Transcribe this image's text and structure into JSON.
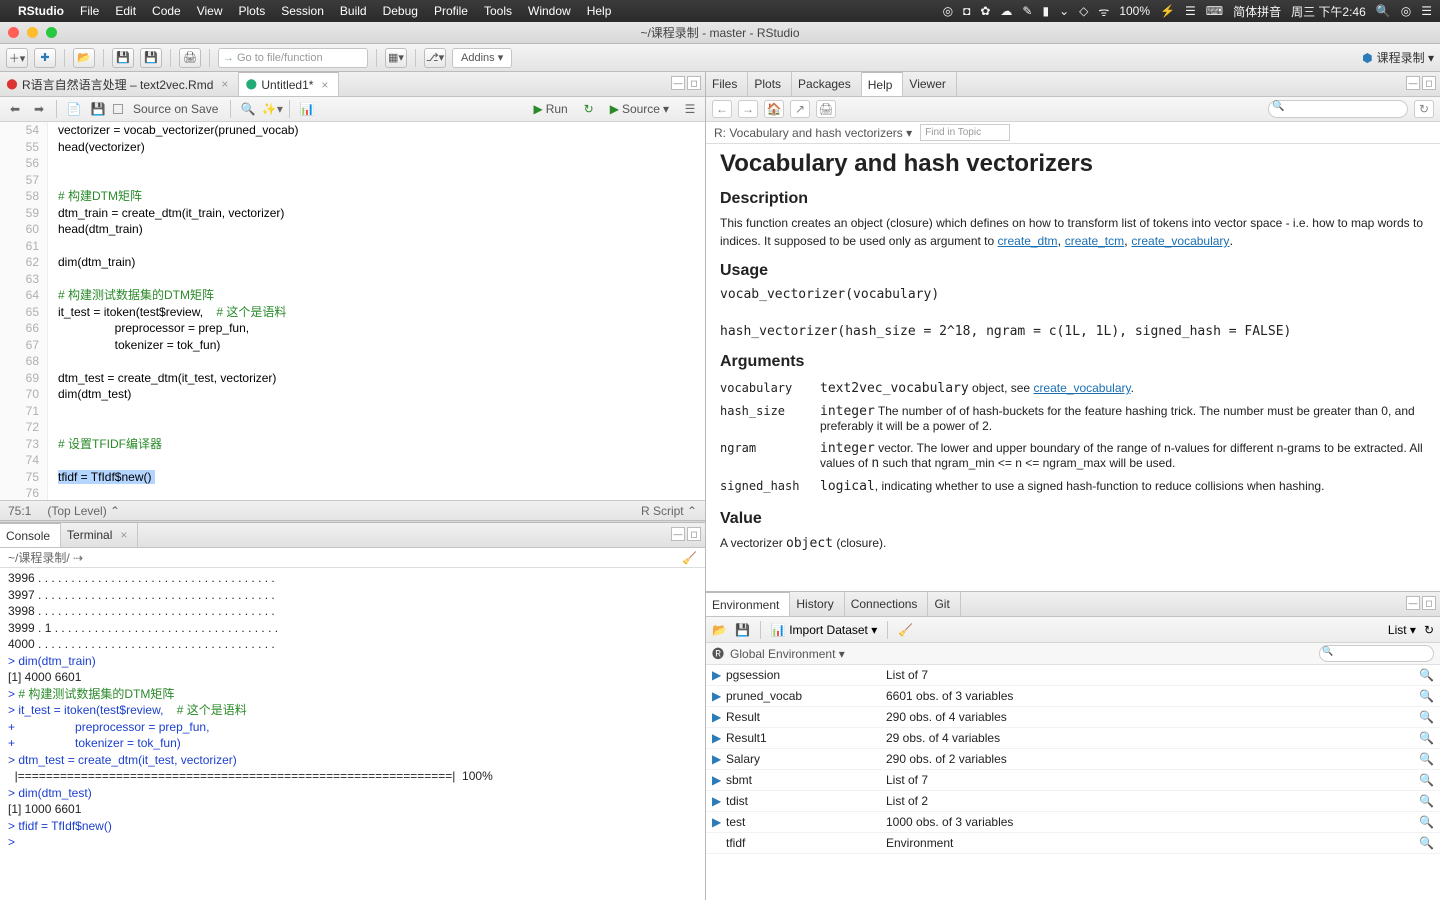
{
  "menubar": {
    "app": "RStudio",
    "items": [
      "File",
      "Edit",
      "Code",
      "View",
      "Plots",
      "Session",
      "Build",
      "Debug",
      "Profile",
      "Tools",
      "Window",
      "Help"
    ],
    "status_right": [
      "◎",
      "◘",
      "✿",
      "☁",
      "✎",
      "▮",
      "⌄",
      "◇",
      "ᯤ",
      "100%",
      "⚡",
      "☰",
      "⌨",
      "简体拼音",
      "周三 下午2:46",
      "🔍",
      "◎",
      "☰"
    ]
  },
  "titlebar": {
    "title": "~/课程录制 - master - RStudio"
  },
  "main_toolbar": {
    "goto_placeholder": "Go to file/function",
    "addins": "Addins  ▾",
    "project": "课程录制 ▾"
  },
  "source": {
    "tabs": [
      {
        "icon": "⬤",
        "label": "R语言自然语言处理 – text2vec.Rmd",
        "closable": true,
        "active": false,
        "icon_color": "#d33"
      },
      {
        "icon": "⬤",
        "label": "Untitled1*",
        "closable": true,
        "active": true,
        "icon_color": "#2a7"
      }
    ],
    "toolbar": {
      "save_on_src": "Source on Save",
      "run": "Run",
      "source_btn": "Source"
    },
    "line_start": 54,
    "lines": [
      {
        "n": 54,
        "t": "vectorizer = vocab_vectorizer(pruned_vocab)"
      },
      {
        "n": 55,
        "t": "head(vectorizer)"
      },
      {
        "n": 56,
        "t": ""
      },
      {
        "n": 57,
        "t": ""
      },
      {
        "n": 58,
        "t": "# 构建DTM矩阵",
        "c": true
      },
      {
        "n": 59,
        "t": "dtm_train = create_dtm(it_train, vectorizer)"
      },
      {
        "n": 60,
        "t": "head(dtm_train)"
      },
      {
        "n": 61,
        "t": ""
      },
      {
        "n": 62,
        "t": "dim(dtm_train)"
      },
      {
        "n": 63,
        "t": ""
      },
      {
        "n": 64,
        "t": "# 构建测试数据集的DTM矩阵",
        "c": true
      },
      {
        "n": 65,
        "t": "it_test = itoken(test$review,    ",
        "tc": "# 这个是语料"
      },
      {
        "n": 66,
        "t": "                 preprocessor = prep_fun,"
      },
      {
        "n": 67,
        "t": "                 tokenizer = tok_fun)"
      },
      {
        "n": 68,
        "t": ""
      },
      {
        "n": 69,
        "t": "dtm_test = create_dtm(it_test, vectorizer)"
      },
      {
        "n": 70,
        "t": "dim(dtm_test)"
      },
      {
        "n": 71,
        "t": ""
      },
      {
        "n": 72,
        "t": ""
      },
      {
        "n": 73,
        "t": "# 设置TFIDF编译器",
        "c": true
      },
      {
        "n": 74,
        "t": ""
      },
      {
        "n": 75,
        "t": "tfidf = TfIdf$new()",
        "sel": true
      },
      {
        "n": 76,
        "t": ""
      }
    ],
    "status_left": "75:1",
    "status_scope": "(Top Level) ⌃",
    "status_right": "R Script ⌃"
  },
  "console": {
    "tabs": [
      "Console",
      "Terminal"
    ],
    "path": "~/课程录制/ ⇢",
    "lines": [
      {
        "t": "3996 . . . . . . . . . . . . . . . . . . . . . . . . . . . . . . . . . . . ."
      },
      {
        "t": "3997 . . . . . . . . . . . . . . . . . . . . . . . . . . . . . . . . . . . ."
      },
      {
        "t": "3998 . . . . . . . . . . . . . . . . . . . . . . . . . . . . . . . . . . . ."
      },
      {
        "t": "3999 . 1 . . . . . . . . . . . . . . . . . . . . . . . . . . . . . . . . . ."
      },
      {
        "t": "4000 . . . . . . . . . . . . . . . . . . . . . . . . . . . . . . . . . . . ."
      },
      {
        "b": "> dim(dtm_train)"
      },
      {
        "t": "[1] 4000 6601"
      },
      {
        "b": "> ",
        "g": "# 构建测试数据集的DTM矩阵"
      },
      {
        "b": "> it_test = itoken(test$review,    ",
        "g": "# 这个是语料"
      },
      {
        "b": "+                  preprocessor = prep_fun,"
      },
      {
        "b": "+                  tokenizer = tok_fun)"
      },
      {
        "b": "> dtm_test = create_dtm(it_test, vectorizer)"
      },
      {
        "t": "  |==============================================================|  100%"
      },
      {
        "b": "> dim(dtm_test)"
      },
      {
        "t": "[1] 1000 6601"
      },
      {
        "b": "> tfidf = TfIdf$new()"
      },
      {
        "b": "> "
      }
    ]
  },
  "help": {
    "tabs": [
      "Files",
      "Plots",
      "Packages",
      "Help",
      "Viewer"
    ],
    "active_tab": "Help",
    "breadcrumb": "R: Vocabulary and hash vectorizers ▾",
    "find_placeholder": "Find in Topic",
    "title": "Vocabulary and hash vectorizers",
    "desc_h": "Description",
    "desc": "This function creates an object (closure) which defines on how to transform list of tokens into vector space - i.e. how to map words to indices. It supposed to be used only as argument to ",
    "desc_links": [
      "create_dtm",
      "create_tcm",
      "create_vocabulary"
    ],
    "usage_h": "Usage",
    "usage": "vocab_vectorizer(vocabulary)\n\nhash_vectorizer(hash_size = 2^18, ngram = c(1L, 1L), signed_hash = FALSE)",
    "args_h": "Arguments",
    "args": [
      {
        "k": "vocabulary",
        "pre": "text2vec_vocabulary",
        "v": " object, see ",
        "link": "create_vocabulary",
        "post": "."
      },
      {
        "k": "hash_size",
        "pre": "integer",
        "v": " The number of of hash-buckets for the feature hashing trick. The number must be greater than 0, and preferably it will be a power of 2."
      },
      {
        "k": "ngram",
        "pre": "integer",
        "v": " vector. The lower and upper boundary of the range of n-values for different n-grams to be extracted. All values of ",
        "code": "n",
        "v2": " such that ngram_min <= n <= ngram_max will be used."
      },
      {
        "k": "signed_hash",
        "pre": "logical",
        "v": ", indicating whether to use a signed hash-function to reduce collisions when hashing."
      }
    ],
    "value_h": "Value",
    "value_pre": "A vectorizer ",
    "value_code": "object",
    "value_post": " (closure)."
  },
  "env": {
    "tabs": [
      "Environment",
      "History",
      "Connections",
      "Git"
    ],
    "active_tab": "Environment",
    "import": "Import Dataset ▾",
    "view": "List ▾",
    "scope": "Global Environment ▾",
    "items": [
      {
        "exp": "▶",
        "n": "pgsession",
        "v": "List of 7",
        "mag": true
      },
      {
        "exp": "▶",
        "n": "pruned_vocab",
        "v": "6601 obs. of 3 variables",
        "mag": true
      },
      {
        "exp": "▶",
        "n": "Result",
        "v": "290 obs. of 4 variables",
        "mag": true
      },
      {
        "exp": "▶",
        "n": "Result1",
        "v": "29 obs. of 4 variables",
        "mag": true
      },
      {
        "exp": "▶",
        "n": "Salary",
        "v": "290 obs. of 2 variables",
        "mag": true
      },
      {
        "exp": "▶",
        "n": "sbmt",
        "v": "List of 7",
        "mag": true
      },
      {
        "exp": "▶",
        "n": "tdist",
        "v": "List of 2",
        "mag": true
      },
      {
        "exp": "▶",
        "n": "test",
        "v": "1000 obs. of 3 variables",
        "mag": true
      },
      {
        "exp": "",
        "n": "  tfidf",
        "v": "Environment",
        "mag": true
      }
    ]
  }
}
